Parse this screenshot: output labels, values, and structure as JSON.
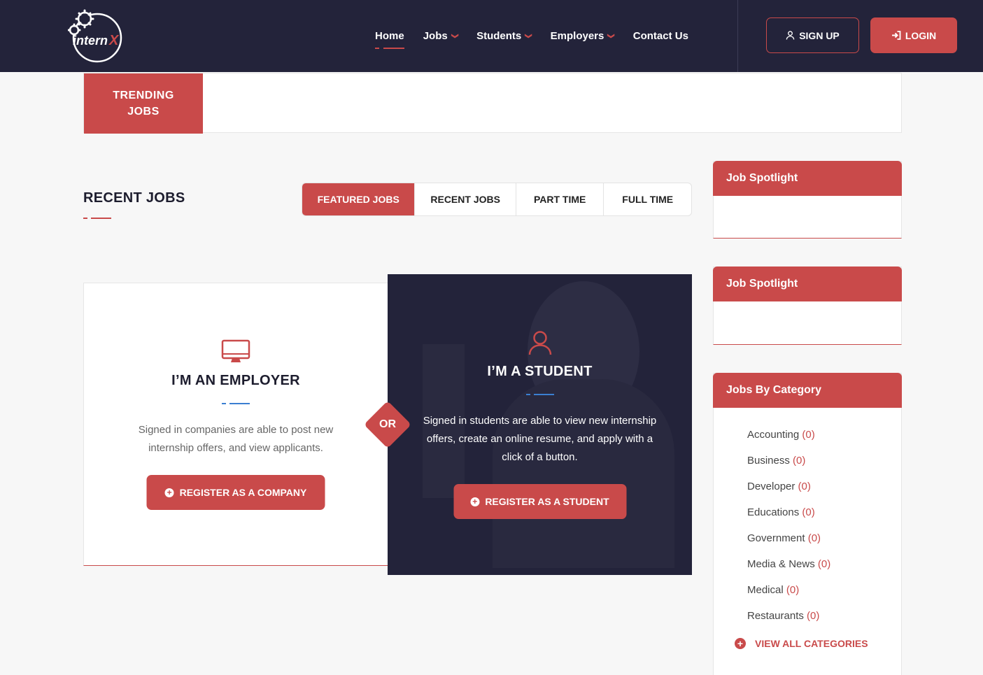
{
  "header": {
    "logo_text": "internX",
    "nav": [
      {
        "label": "Home",
        "active": true,
        "dropdown": false
      },
      {
        "label": "Jobs",
        "active": false,
        "dropdown": true
      },
      {
        "label": "Students",
        "active": false,
        "dropdown": true
      },
      {
        "label": "Employers",
        "active": false,
        "dropdown": true
      },
      {
        "label": "Contact Us",
        "active": false,
        "dropdown": false
      }
    ],
    "signup_label": "SIGN UP",
    "login_label": "LOGIN"
  },
  "trending": {
    "label": "TRENDING JOBS"
  },
  "recent_jobs": {
    "title": "RECENT JOBS",
    "tabs": [
      {
        "label": "FEATURED JOBS",
        "active": true
      },
      {
        "label": "RECENT JOBS",
        "active": false
      },
      {
        "label": "PART TIME",
        "active": false
      },
      {
        "label": "FULL TIME",
        "active": false
      }
    ]
  },
  "employer_card": {
    "icon": "monitor-icon",
    "title": "I’M AN EMPLOYER",
    "text": "Signed in companies are able to post new internship offers, and view applicants.",
    "button": "REGISTER AS A COMPANY"
  },
  "or_label": "OR",
  "student_card": {
    "icon": "user-icon",
    "title": "I’M A STUDENT",
    "text": "Signed in students are able to view new internship offers, create an online resume, and apply with a click of a button.",
    "button": "REGISTER AS A STUDENT"
  },
  "sidebar": {
    "spotlight1_title": "Job Spotlight",
    "spotlight2_title": "Job Spotlight",
    "categories_title": "Jobs By Category",
    "categories": [
      {
        "name": "Accounting",
        "count": "(0)"
      },
      {
        "name": "Business",
        "count": "(0)"
      },
      {
        "name": "Developer",
        "count": "(0)"
      },
      {
        "name": "Educations",
        "count": "(0)"
      },
      {
        "name": "Government",
        "count": "(0)"
      },
      {
        "name": "Media & News",
        "count": "(0)"
      },
      {
        "name": "Medical",
        "count": "(0)"
      },
      {
        "name": "Restaurants",
        "count": "(0)"
      }
    ],
    "view_all_label": "VIEW ALL CATEGORIES"
  },
  "colors": {
    "accent": "#c94a4a",
    "dark": "#23233a",
    "background": "#f7f7f7",
    "link_underline": "#3b7fd1"
  }
}
